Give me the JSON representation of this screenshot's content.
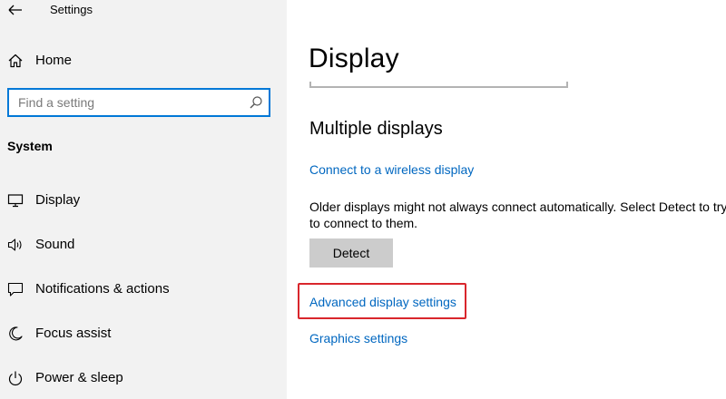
{
  "window": {
    "title": "Settings"
  },
  "sidebar": {
    "home_label": "Home",
    "search": {
      "placeholder": "Find a setting",
      "value": ""
    },
    "section_label": "System",
    "items": [
      {
        "label": "Display",
        "icon": "monitor-icon"
      },
      {
        "label": "Sound",
        "icon": "speaker-icon"
      },
      {
        "label": "Notifications & actions",
        "icon": "notification-icon"
      },
      {
        "label": "Focus assist",
        "icon": "moon-icon"
      },
      {
        "label": "Power & sleep",
        "icon": "power-icon"
      }
    ]
  },
  "main": {
    "page_title": "Display",
    "section_heading": "Multiple displays",
    "connect_link": "Connect to a wireless display",
    "detect_description": "Older displays might not always connect automatically. Select Detect to try to connect to them.",
    "detect_button": "Detect",
    "advanced_link": "Advanced display settings",
    "graphics_link": "Graphics settings"
  },
  "colors": {
    "accent": "#0078d7",
    "link": "#0067c0",
    "sidebar_bg": "#f2f2f2",
    "button_bg": "#cccccc",
    "highlight": "#d9262c"
  }
}
